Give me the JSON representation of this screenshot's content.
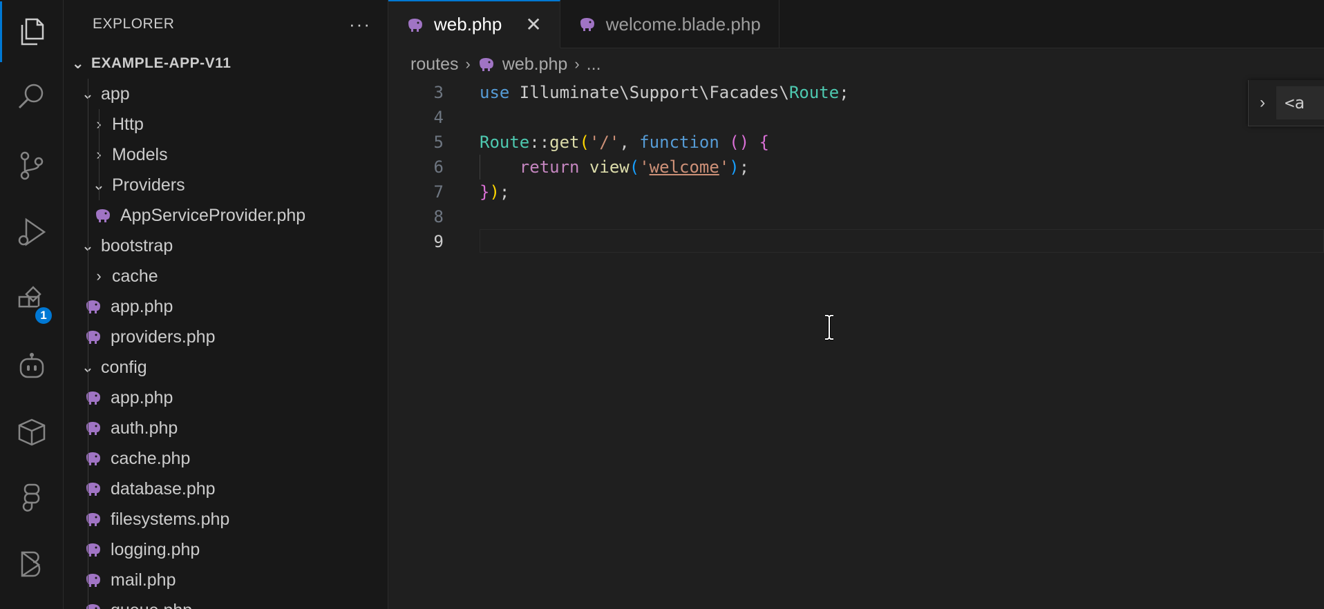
{
  "activity_bar": {
    "icons": [
      "explorer-icon",
      "search-icon",
      "source-control-icon",
      "run-debug-icon",
      "extensions-icon",
      "copilot-icon",
      "package-icon",
      "figma-icon",
      "bolt-icon"
    ],
    "extensions_badge": "1"
  },
  "sidebar": {
    "title": "EXPLORER",
    "more": "···",
    "root": "EXAMPLE-APP-V11",
    "items": [
      {
        "label": "app",
        "kind": "folder-open"
      },
      {
        "label": "Http",
        "kind": "folder-closed"
      },
      {
        "label": "Models",
        "kind": "folder-closed"
      },
      {
        "label": "Providers",
        "kind": "folder-open"
      },
      {
        "label": "AppServiceProvider.php",
        "kind": "php-file"
      },
      {
        "label": "bootstrap",
        "kind": "folder-open"
      },
      {
        "label": "cache",
        "kind": "folder-closed"
      },
      {
        "label": "app.php",
        "kind": "php-file"
      },
      {
        "label": "providers.php",
        "kind": "php-file"
      },
      {
        "label": "config",
        "kind": "folder-open"
      },
      {
        "label": "app.php",
        "kind": "php-file"
      },
      {
        "label": "auth.php",
        "kind": "php-file"
      },
      {
        "label": "cache.php",
        "kind": "php-file"
      },
      {
        "label": "database.php",
        "kind": "php-file"
      },
      {
        "label": "filesystems.php",
        "kind": "php-file"
      },
      {
        "label": "logging.php",
        "kind": "php-file"
      },
      {
        "label": "mail.php",
        "kind": "php-file"
      },
      {
        "label": "queue.php",
        "kind": "php-file"
      }
    ]
  },
  "editor": {
    "tabs": [
      {
        "label": "web.php",
        "active": true,
        "close": "✕"
      },
      {
        "label": "welcome.blade.php",
        "active": false
      }
    ],
    "breadcrumb": {
      "folder": "routes",
      "file": "web.php",
      "more": "..."
    },
    "line_numbers": [
      "3",
      "4",
      "5",
      "6",
      "7",
      "8",
      "9"
    ],
    "current_line": "9",
    "sticky_widget": {
      "chevron": "›",
      "text": "<a"
    }
  },
  "colors": {
    "accent": "#0078d4",
    "php_icon": "#a074c4"
  }
}
